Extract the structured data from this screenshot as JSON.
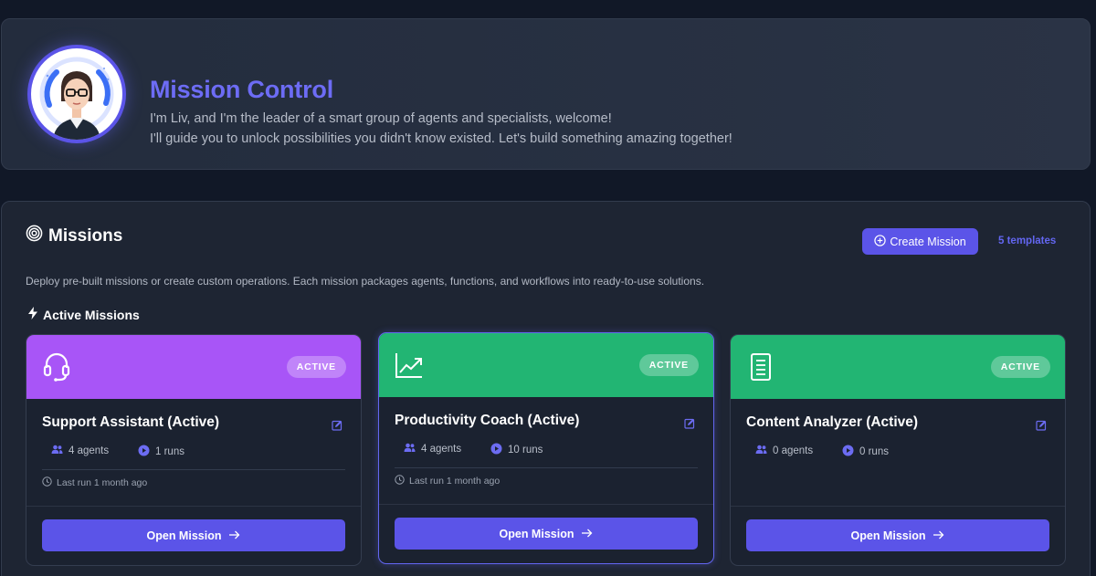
{
  "hero": {
    "title": "Mission Control",
    "line1": "I'm Liv, and I'm the leader of a smart group of agents and specialists, welcome!",
    "line2": "I'll guide you to unlock possibilities you didn't know existed. Let's build something amazing together!",
    "avatar_icon": "liv-avatar"
  },
  "missions": {
    "title": "Missions",
    "title_icon": "target-icon",
    "create_label": "Create Mission",
    "create_icon": "plus-circle-icon",
    "templates_count": "5 templates",
    "description": "Deploy pre-built missions or create custom operations. Each mission packages agents, functions, and workflows into ready-to-use solutions.",
    "active_title": "Active Missions",
    "active_icon": "bolt-icon"
  },
  "cards": [
    {
      "title": "Support Assistant (Active)",
      "badge": "ACTIVE",
      "header_color": "#a855f7",
      "icon": "headset-icon",
      "agents": "4 agents",
      "runs": "1 runs",
      "last_run": "Last run 1 month ago",
      "open_label": "Open Mission"
    },
    {
      "title": "Productivity Coach (Active)",
      "badge": "ACTIVE",
      "header_color": "#22b573",
      "icon": "trend-chart-icon",
      "agents": "4 agents",
      "runs": "10 runs",
      "last_run": "Last run 1 month ago",
      "open_label": "Open Mission"
    },
    {
      "title": "Content Analyzer (Active)",
      "badge": "ACTIVE",
      "header_color": "#22b573",
      "icon": "document-icon",
      "agents": "0 agents",
      "runs": "0 runs",
      "last_run": "",
      "open_label": "Open Mission"
    }
  ]
}
